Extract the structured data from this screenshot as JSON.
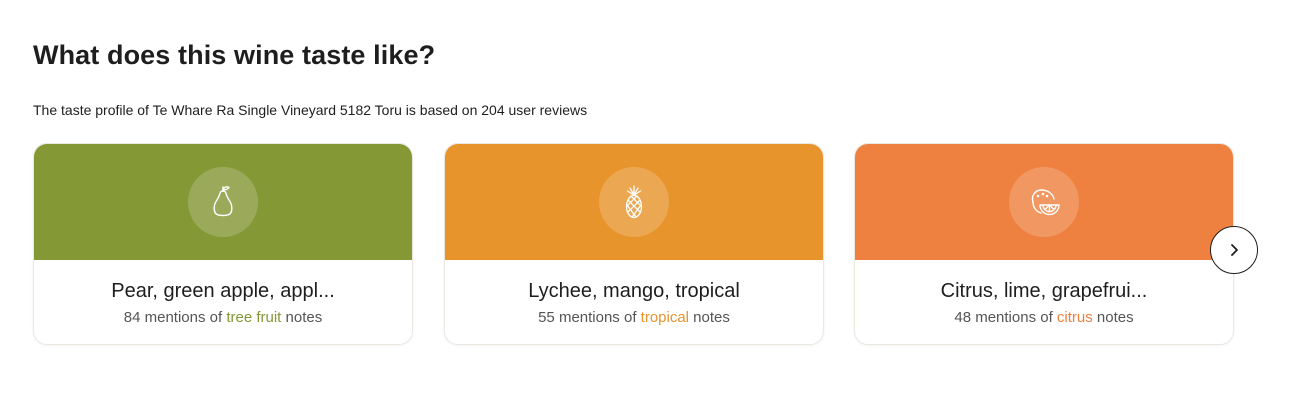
{
  "section": {
    "title": "What does this wine taste like?",
    "subtitle": "The taste profile of Te Whare Ra Single Vineyard 5182 Toru is based on 204 user reviews"
  },
  "cards": [
    {
      "name": "Pear, green apple, appl...",
      "count_text": "84 mentions of ",
      "category": "tree fruit",
      "suffix": " notes",
      "icon": "pear-icon",
      "color": "#849836"
    },
    {
      "name": "Lychee, mango, tropical",
      "count_text": "55 mentions of ",
      "category": "tropical",
      "suffix": " notes",
      "icon": "pineapple-icon",
      "color": "#e8942c"
    },
    {
      "name": "Citrus, lime, grapefrui...",
      "count_text": "48 mentions of ",
      "category": "citrus",
      "suffix": " notes",
      "icon": "citrus-icon",
      "color": "#ee8140"
    }
  ],
  "next_button": {
    "icon": "chevron-right-icon"
  }
}
